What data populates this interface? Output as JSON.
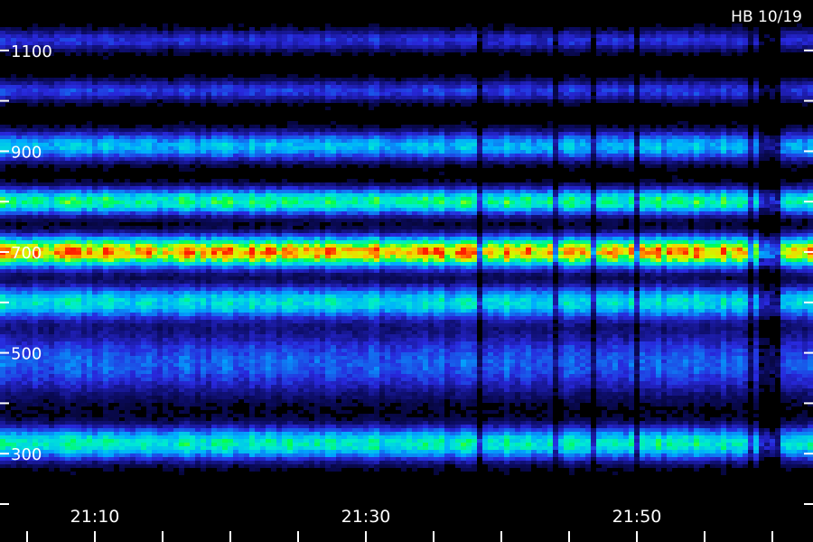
{
  "chart_data": {
    "type": "heatmap",
    "title": "",
    "corner_label": "HB 10/19",
    "xlabel": "",
    "ylabel": "",
    "x_time_range": [
      "21:03",
      "22:03"
    ],
    "x_tick_labels": [
      "21:10",
      "21:30",
      "21:50"
    ],
    "x_tick_labels_values": [
      "21:10",
      "21:30",
      "21:50"
    ],
    "y_range": [
      200,
      1200
    ],
    "y_tick_labels": [
      "1100",
      "900",
      "700",
      "500",
      "300"
    ],
    "y_minor_ticks": [
      200,
      300,
      400,
      500,
      600,
      700,
      800,
      900,
      1000,
      1100
    ],
    "bands": [
      {
        "center": 1120,
        "width": 20,
        "intensity": 0.18
      },
      {
        "center": 1020,
        "width": 20,
        "intensity": 0.2
      },
      {
        "center": 910,
        "width": 26,
        "intensity": 0.38
      },
      {
        "center": 800,
        "width": 24,
        "intensity": 0.55
      },
      {
        "center": 700,
        "width": 28,
        "intensity": 0.86
      },
      {
        "center": 600,
        "width": 30,
        "intensity": 0.45
      },
      {
        "center": 480,
        "width": 60,
        "intensity": 0.25
      },
      {
        "center": 320,
        "width": 30,
        "intensity": 0.5
      }
    ],
    "colors": {
      "background": "#000000",
      "low": "#1a1aa0",
      "mid_low": "#00b4ff",
      "mid": "#00ff66",
      "mid_high": "#ffff00",
      "high": "#ff2000",
      "text": "#ffffff"
    }
  }
}
